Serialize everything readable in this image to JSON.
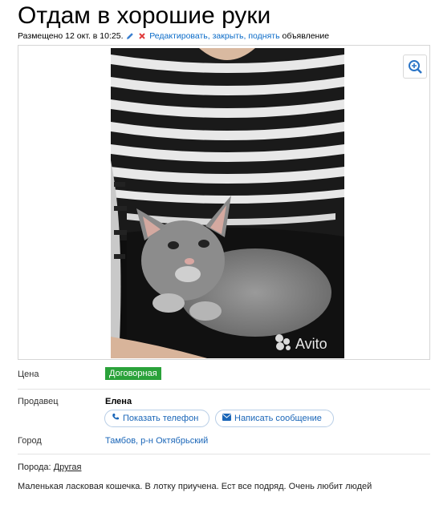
{
  "listing": {
    "title": "Отдам в хорошие руки",
    "posted": "Размещено 12 окт. в 10:25.",
    "actions": "Редактировать, закрыть, поднять",
    "actions_suffix": "объявление"
  },
  "photo": {
    "watermark": "Avito"
  },
  "details": {
    "price_label": "Цена",
    "price_value": "Договорная",
    "seller_label": "Продавец",
    "seller_name": "Елена",
    "show_phone": "Показать телефон",
    "send_message": "Написать сообщение",
    "city_label": "Город",
    "city_value": "Тамбов, р-н Октябрьский"
  },
  "description": {
    "breed_label": "Порода:",
    "breed_value": "Другая",
    "text": "Маленькая ласковая кошечка. В лотку приучена. Ест все подряд. Очень любит людей"
  },
  "colors": {
    "price_badge": "#2aa23a",
    "link": "#1a66b8",
    "close_x": "#e03a3a"
  }
}
